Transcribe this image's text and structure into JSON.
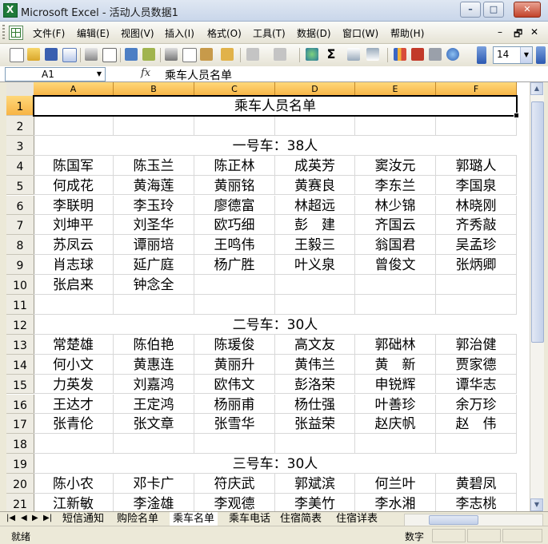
{
  "window": {
    "title": "Microsoft Excel - 活动人员数据1"
  },
  "menu": [
    "文件(F)",
    "编辑(E)",
    "视图(V)",
    "插入(I)",
    "格式(O)",
    "工具(T)",
    "数据(D)",
    "窗口(W)",
    "帮助(H)"
  ],
  "toolbar": {
    "font_size": "14"
  },
  "formula": {
    "name_box": "A1",
    "fx": "fx",
    "content": "乘车人员名单"
  },
  "columns": [
    "A",
    "B",
    "C",
    "D",
    "E",
    "F"
  ],
  "rows": [
    {
      "num": "1",
      "merged": "乘车人员名单"
    },
    {
      "num": "2",
      "cells": [
        "",
        "",
        "",
        "",
        "",
        ""
      ]
    },
    {
      "num": "3",
      "merged": "一号车：38人"
    },
    {
      "num": "4",
      "cells": [
        "陈国军",
        "陈玉兰",
        "陈正林",
        "成英芳",
        "窦汝元",
        "郭璐人"
      ]
    },
    {
      "num": "5",
      "cells": [
        "何成花",
        "黄海莲",
        "黄丽铭",
        "黄赛良",
        "李东兰",
        "李国泉"
      ]
    },
    {
      "num": "6",
      "cells": [
        "李联明",
        "李玉玲",
        "廖德富",
        "林超远",
        "林少锦",
        "林晓刚"
      ]
    },
    {
      "num": "7",
      "cells": [
        "刘坤平",
        "刘圣华",
        "欧巧细",
        "彭　建",
        "齐国云",
        "齐秀敲"
      ]
    },
    {
      "num": "8",
      "cells": [
        "苏凤云",
        "谭丽培",
        "王鸣伟",
        "王毅三",
        "翁国君",
        "吴孟珍"
      ]
    },
    {
      "num": "9",
      "cells": [
        "肖志球",
        "延广庭",
        "杨广胜",
        "叶义泉",
        "曾俊文",
        "张炳卿"
      ]
    },
    {
      "num": "10",
      "cells": [
        "张启来",
        "钟念全",
        "",
        "",
        "",
        ""
      ]
    },
    {
      "num": "11",
      "cells": [
        "",
        "",
        "",
        "",
        "",
        ""
      ]
    },
    {
      "num": "12",
      "merged": "二号车：30人"
    },
    {
      "num": "13",
      "cells": [
        "常楚雄",
        "陈伯艳",
        "陈瑗俊",
        "高文友",
        "郭础林",
        "郭治健"
      ]
    },
    {
      "num": "14",
      "cells": [
        "何小文",
        "黄惠连",
        "黄丽升",
        "黄伟兰",
        "黄　新",
        "贾家德"
      ]
    },
    {
      "num": "15",
      "cells": [
        "力英发",
        "刘嘉鸿",
        "欧伟文",
        "彭洛荣",
        "申锐辉",
        "谭华志"
      ]
    },
    {
      "num": "16",
      "cells": [
        "王达才",
        "王定鸿",
        "杨丽甫",
        "杨仕强",
        "叶善珍",
        "余万珍"
      ]
    },
    {
      "num": "17",
      "cells": [
        "张青伦",
        "张文章",
        "张雪华",
        "张益荣",
        "赵庆帆",
        "赵　伟"
      ]
    },
    {
      "num": "18",
      "cells": [
        "",
        "",
        "",
        "",
        "",
        ""
      ]
    },
    {
      "num": "19",
      "merged": "三号车：30人"
    },
    {
      "num": "20",
      "cells": [
        "陈小农",
        "邓卡广",
        "符庆武",
        "郭斌滨",
        "何兰叶",
        "黄碧凤"
      ]
    },
    {
      "num": "21",
      "cells": [
        "江新敏",
        "李淦雄",
        "李观德",
        "李美竹",
        "李水湘",
        "李志桃"
      ]
    }
  ],
  "sheet_tabs": [
    "短信通知",
    "购险名单",
    "乘车名单",
    "乘车电话",
    "住宿简表",
    "住宿详表"
  ],
  "active_tab": 2,
  "status": {
    "left": "就绪",
    "mode": "数字"
  },
  "colors": {
    "accent": "#f7b445",
    "titlebar": "#c9d6ea"
  }
}
